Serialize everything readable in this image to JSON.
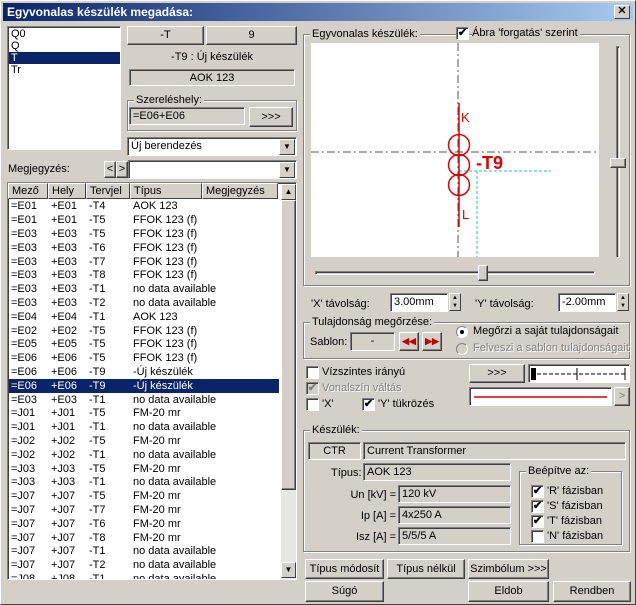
{
  "window": {
    "title": "Egyvonalas készülék megadása:",
    "close": "✕"
  },
  "phase_list": [
    "Q0",
    "Q",
    "T",
    "Tr"
  ],
  "phase_selected_index": 2,
  "top_buttons": {
    "minus_t": "-T",
    "nine": "9"
  },
  "device_label": "-T9 : Új készülék",
  "device_type_box": "AOK 123",
  "location": {
    "group": "Szereléshely:",
    "value": "=E06+E06",
    "button": ">>>"
  },
  "new_device_select": "Új berendezés",
  "note": {
    "label": "Megjegyzés:",
    "prev": "<",
    "next": ">",
    "value": ""
  },
  "table": {
    "headers": [
      "Mező",
      "Hely",
      "Tervjel",
      "Típus",
      "Megjegyzés"
    ],
    "selected_index": 13,
    "rows": [
      [
        "=E01",
        "+E01",
        "-T4",
        "AOK 123"
      ],
      [
        "=E01",
        "+E01",
        "-T5",
        "FFOK 123 (f)"
      ],
      [
        "=E03",
        "+E03",
        "-T5",
        "FFOK 123 (f)"
      ],
      [
        "=E03",
        "+E03",
        "-T6",
        "FFOK 123 (f)"
      ],
      [
        "=E03",
        "+E03",
        "-T7",
        "FFOK 123 (f)"
      ],
      [
        "=E03",
        "+E03",
        "-T8",
        "FFOK 123 (f)"
      ],
      [
        "=E03",
        "+E03",
        "-T1",
        "no data available"
      ],
      [
        "=E03",
        "+E03",
        "-T2",
        "no data available"
      ],
      [
        "=E04",
        "+E04",
        "-T1",
        "AOK 123"
      ],
      [
        "=E02",
        "+E02",
        "-T5",
        "FFOK 123 (f)"
      ],
      [
        "=E05",
        "+E05",
        "-T5",
        "FFOK 123 (f)"
      ],
      [
        "=E06",
        "+E06",
        "-T5",
        "FFOK 123 (f)"
      ],
      [
        "=E06",
        "+E06",
        "-T9",
        "-Új készülék"
      ],
      [
        "=E06",
        "+E06",
        "-T9",
        "-Új készülék"
      ],
      [
        "=E03",
        "+E03",
        "-T1",
        "no data available"
      ],
      [
        "=J01",
        "+J01",
        "-T5",
        "FM-20 mr"
      ],
      [
        "=J01",
        "+J01",
        "-T1",
        "no data available"
      ],
      [
        "=J02",
        "+J02",
        "-T5",
        "FM-20 mr"
      ],
      [
        "=J02",
        "+J02",
        "-T1",
        "no data available"
      ],
      [
        "=J03",
        "+J03",
        "-T5",
        "FM-20 mr"
      ],
      [
        "=J03",
        "+J03",
        "-T1",
        "no data available"
      ],
      [
        "=J07",
        "+J07",
        "-T5",
        "FM-20 mr"
      ],
      [
        "=J07",
        "+J07",
        "-T7",
        "FM-20 mr"
      ],
      [
        "=J07",
        "+J07",
        "-T6",
        "FM-20 mr"
      ],
      [
        "=J07",
        "+J07",
        "-T8",
        "FM-20 mr"
      ],
      [
        "=J07",
        "+J07",
        "-T1",
        "no data available"
      ],
      [
        "=J07",
        "+J07",
        "-T2",
        "no data available"
      ],
      [
        "=J08",
        "+J08",
        "-T1",
        "no data available"
      ]
    ]
  },
  "preview": {
    "group": "Egyvonalas készülék:",
    "rotate_checkbox": "Ábra 'forgatás' szerint",
    "rotate_checked": true,
    "symbol_label": "-T9",
    "pin_top": "K",
    "pin_bottom": "L",
    "symbol_color": "#e00000"
  },
  "distance": {
    "x_label": "'X' távolság:",
    "x_value": "3.00mm",
    "y_label": "'Y' távolság:",
    "y_value": "-2.00mm"
  },
  "retention": {
    "group": "Tulajdonság megőrzése:",
    "template_label": "Sablon:",
    "template_value": "-",
    "radio_keep": "Megőrzi a saját tulajdonságait",
    "radio_take": "Felveszi a sablon tulajdonságait"
  },
  "options": {
    "horizontal": "Vízszintes irányú",
    "color_change": "Vonalszín váltás",
    "x_mirror": "'X'",
    "y_mirror": "'Y' tükrözés",
    "line_button": ">>>",
    "line_arrow": ">"
  },
  "device": {
    "group": "Készülék:",
    "code": "CTR",
    "name": "Current Transformer",
    "type_label": "Típus:",
    "type_value": "AOK 123",
    "un_label": "Un [kV] =",
    "un_value": "120 kV",
    "ip_label": "Ip [A] =",
    "ip_value": "4x250 A",
    "isz_label": "Isz [A] =",
    "isz_value": "5/5/5 A",
    "phases_group": "Beépítve az:",
    "phases": [
      "'R' fázisban",
      "'S' fázisban",
      "'T' fázisban",
      "'N' fázisban"
    ],
    "phases_checked": [
      true,
      true,
      true,
      false
    ]
  },
  "bottom_buttons": {
    "type_modify": "Típus módosít",
    "no_type": "Típus nélkül",
    "symbol": "Szimbólum >>>",
    "help": "Súgó",
    "discard": "Eldob",
    "ok": "Rendben"
  }
}
